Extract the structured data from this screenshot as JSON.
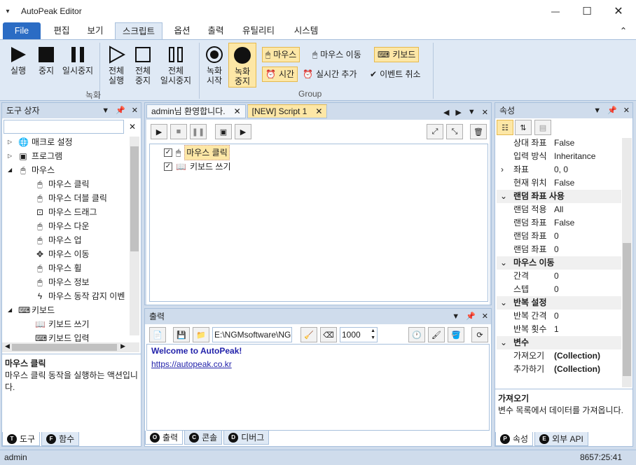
{
  "window": {
    "title": "AutoPeak Editor",
    "quick_access": "▾",
    "minimize": "—",
    "maximize": "☐",
    "close": "✕"
  },
  "menu": {
    "file": "File",
    "tabs": [
      "편집",
      "보기",
      "스크립트",
      "옵션",
      "출력",
      "유틸리티",
      "시스템"
    ],
    "collapse": "⌃"
  },
  "ribbon": {
    "record_group": "녹화",
    "group2": "Group",
    "run": "실행",
    "stop": "중지",
    "pause": "일시중지",
    "run_all_1": "전체",
    "run_all_2": "실행",
    "stop_all_1": "전체",
    "stop_all_2": "중지",
    "pause_all_1": "전체",
    "pause_all_2": "일시중지",
    "rec_start_1": "녹화",
    "rec_start_2": "시작",
    "rec_stop_1": "녹화",
    "rec_stop_2": "중지",
    "mouse": "마우스",
    "mouse_move": "마우스 이동",
    "keyboard": "키보드",
    "time": "시간",
    "realtime_add": "실시간 추가",
    "event_cancel": "이벤트 취소"
  },
  "toolbox": {
    "title": "도구 상자",
    "search_value": "",
    "items": [
      {
        "label": "매크로 설정",
        "icon": "globe-icon"
      },
      {
        "label": "프로그램",
        "icon": "program-icon"
      },
      {
        "label": "마우스",
        "icon": "mouse-icon"
      },
      {
        "label": "마우스 클릭",
        "icon": "mouse-click-icon"
      },
      {
        "label": "마우스 더블 클릭",
        "icon": "mouse-double-click-icon"
      },
      {
        "label": "마우스 드래그",
        "icon": "mouse-drag-icon"
      },
      {
        "label": "마우스 다운",
        "icon": "mouse-down-icon"
      },
      {
        "label": "마우스 업",
        "icon": "mouse-up-icon"
      },
      {
        "label": "마우스 이동",
        "icon": "move-icon"
      },
      {
        "label": "마우스 휠",
        "icon": "mouse-wheel-icon"
      },
      {
        "label": "마우스 정보",
        "icon": "mouse-info-icon"
      },
      {
        "label": "마우스 동작 감지 이벤",
        "icon": "lightning-icon"
      },
      {
        "label": "키보드",
        "icon": "keyboard-icon"
      },
      {
        "label": "키보드 쓰기",
        "icon": "book-icon"
      },
      {
        "label": "키보드 입력",
        "icon": "keyboard-icon"
      }
    ],
    "desc_title": "마우스 클릭",
    "desc_text": "마우스 클릭 동작을 실행하는 액션입니다.",
    "tab_tools": "도구",
    "tab_functions": "함수",
    "tab_tools_key": "T",
    "tab_functions_key": "F"
  },
  "editor": {
    "tab1": "admin님 환영합니다.",
    "tab2": "[NEW] Script 1",
    "steps": [
      "마우스 클릭",
      "키보드 쓰기"
    ]
  },
  "output": {
    "title": "출력",
    "path": "E:\\NGMsoftware\\NG",
    "count": "1000",
    "welcome": "Welcome to AutoPeak!",
    "link": "https://autopeak.co.kr",
    "tab_output": "출력",
    "tab_console": "콘솔",
    "tab_debug": "디버그",
    "tab_output_key": "O",
    "tab_console_key": "C",
    "tab_debug_key": "D"
  },
  "properties": {
    "title": "속성",
    "rows": [
      {
        "type": "row",
        "k": "상대 좌표",
        "v": "False"
      },
      {
        "type": "row",
        "k": "입력 방식",
        "v": "Inheritance"
      },
      {
        "type": "row",
        "k": "좌표",
        "v": "0, 0",
        "expander": "›"
      },
      {
        "type": "row",
        "k": "현재 위치",
        "v": "False"
      },
      {
        "type": "cat",
        "k": "랜덤 좌표 사용"
      },
      {
        "type": "row",
        "k": "랜덤 적용",
        "v": "All"
      },
      {
        "type": "row",
        "k": "랜덤 좌표",
        "v": "False"
      },
      {
        "type": "row",
        "k": "랜덤 좌표",
        "v": "0"
      },
      {
        "type": "row",
        "k": "랜덤 좌표",
        "v": "0"
      },
      {
        "type": "cat",
        "k": "마우스 이동"
      },
      {
        "type": "row",
        "k": "간격",
        "v": "0"
      },
      {
        "type": "row",
        "k": "스텝",
        "v": "0"
      },
      {
        "type": "cat",
        "k": "반복 설정"
      },
      {
        "type": "row",
        "k": "반복 간격",
        "v": "0"
      },
      {
        "type": "row",
        "k": "반복 횟수",
        "v": "1"
      },
      {
        "type": "cat",
        "k": "변수"
      },
      {
        "type": "row",
        "k": "가져오기",
        "v": "(Collection)",
        "bold": true
      },
      {
        "type": "row",
        "k": "추가하기",
        "v": "(Collection)",
        "bold": true
      }
    ],
    "desc_title": "가져오기",
    "desc_text": "변수 목록에서 데이터를 가져옵니다.",
    "tab_props": "속성",
    "tab_api": "외부 API",
    "tab_props_key": "P",
    "tab_api_key": "E"
  },
  "status": {
    "user": "admin",
    "time": "8657:25:41"
  }
}
